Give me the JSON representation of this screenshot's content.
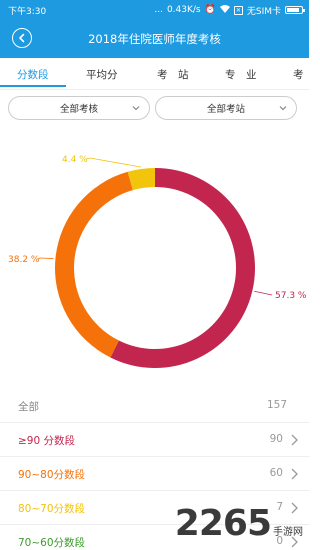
{
  "status_bar": {
    "time": "下午3:30",
    "network_speed": "0.43K/s",
    "sim_label": "无SIM卡",
    "ellipsis": "...",
    "mini_icon": "✕"
  },
  "header": {
    "title": "2018年住院医师年度考核",
    "back_icon": "back-arrow-icon"
  },
  "tabs": [
    {
      "label": "分数段",
      "active": true
    },
    {
      "label": "平均分"
    },
    {
      "label": "考　站"
    },
    {
      "label": "专　业"
    },
    {
      "label": "考"
    }
  ],
  "filters": {
    "exam": "全部考核",
    "station": "全部考站"
  },
  "chart_data": {
    "type": "pie",
    "donut": true,
    "slices": [
      {
        "label": "57.3 %",
        "value": 57.3,
        "color": "#c2264f"
      },
      {
        "label": "38.2 %",
        "value": 38.2,
        "color": "#f5720a"
      },
      {
        "label": "4.4 %",
        "value": 4.4,
        "color": "#f2c40c"
      }
    ]
  },
  "list": {
    "total": {
      "label": "全部",
      "count": "157"
    },
    "rows": [
      {
        "label": "≥90 分数段",
        "count": "90",
        "color": "#c2264f"
      },
      {
        "label": "90~80分数段",
        "count": "60",
        "color": "#f5720a"
      },
      {
        "label": "80~70分数段",
        "count": "7",
        "color": "#f2c40c"
      },
      {
        "label": "70~60分数段",
        "count": "0",
        "color": "#3c9a2c"
      }
    ]
  },
  "watermark": {
    "digits": "2265",
    "text": "手游网"
  }
}
